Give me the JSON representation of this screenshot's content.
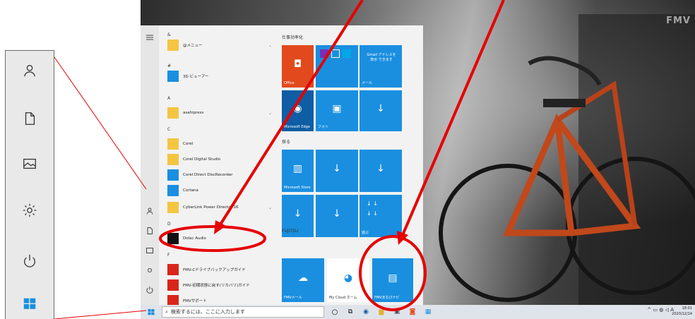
{
  "colors": {
    "accent": "#1a8fe0",
    "office": "#e24a1d",
    "annotation": "#e60000",
    "edge": "#0f5da5"
  },
  "zoom_rail": {
    "icons": [
      "user-icon",
      "document-icon",
      "pictures-icon",
      "settings-icon",
      "power-icon",
      "windows-icon"
    ]
  },
  "start_menu": {
    "letters": [
      "&",
      "#",
      "A",
      "C",
      "D",
      "F"
    ],
    "apps": [
      {
        "label": "@メニュー",
        "icon": "folder-icon"
      },
      {
        "label": "3D ビューアー",
        "icon": "cube-icon"
      },
      {
        "label": "asahipress",
        "icon": "folder-icon"
      },
      {
        "label": "Corel",
        "icon": "folder-icon"
      },
      {
        "label": "Corel Digital Studio",
        "icon": "folder-icon"
      },
      {
        "label": "Corel Direct DiscRecorder",
        "icon": "disc-icon"
      },
      {
        "label": "Cortana",
        "icon": "cortana-icon"
      },
      {
        "label": "CyberLink Power Director 16",
        "icon": "folder-icon"
      },
      {
        "label": "Dolac Audio",
        "icon": "audio-icon"
      },
      {
        "label": "FMV-Cドライブバックアップガイド",
        "icon": "guide-icon"
      },
      {
        "label": "FMV-初期状態に戻す(リカバリ)ガイド",
        "icon": "guide-icon"
      },
      {
        "label": "FMVサポート",
        "icon": "support-icon"
      }
    ],
    "groups": {
      "productivity": "仕事効率化",
      "explore": "探る",
      "fujitsu": "FUJITSU"
    },
    "tiles": {
      "office": "Office",
      "mail_text": "Gmail アドレスを 表示 できます",
      "mail": "メール",
      "edge": "Microsoft Edge",
      "photos": "フォト",
      "store": "Microsoft Store",
      "play": "遊ぶ",
      "fmv_mail": "FMVメール",
      "mycloud": "My Cloud ホーム",
      "fmv_navi": "FMVまなびナビ"
    }
  },
  "taskbar": {
    "search_placeholder": "検索するには、ここに入力します",
    "tray_ime": "A",
    "clock_time": "18:01",
    "clock_date": "2020/12/14"
  },
  "desktop": {
    "brand": "FMV"
  }
}
